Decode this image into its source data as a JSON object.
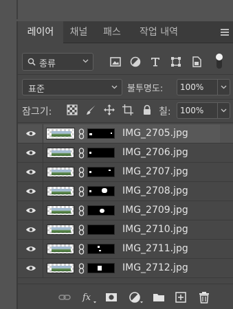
{
  "tabs": [
    {
      "label": "레이어",
      "active": true
    },
    {
      "label": "채널",
      "active": false
    },
    {
      "label": "패스",
      "active": false
    },
    {
      "label": "작업 내역",
      "active": false
    }
  ],
  "filter": {
    "kind_label": "종류",
    "icons": [
      "pixel-layer-filter-icon",
      "adjustment-layer-filter-icon",
      "type-layer-filter-icon",
      "shape-layer-filter-icon",
      "smart-object-filter-icon",
      "filter-toggle-icon"
    ]
  },
  "blend": {
    "mode": "표준",
    "opacity_label": "불투명도:",
    "opacity_value": "100%"
  },
  "lock": {
    "label": "잠그기:",
    "icons": [
      "lock-transparent-pixels-icon",
      "lock-image-pixels-icon",
      "lock-position-icon",
      "lock-artboard-icon",
      "lock-all-icon"
    ],
    "fill_label": "칠:",
    "fill_value": "100%"
  },
  "layers": [
    {
      "name": "IMG_2705.jpg",
      "selected": true,
      "visible": true
    },
    {
      "name": "IMG_2706.jpg",
      "selected": false,
      "visible": true
    },
    {
      "name": "IMG_2707.jpg",
      "selected": false,
      "visible": true
    },
    {
      "name": "IMG_2708.jpg",
      "selected": false,
      "visible": true
    },
    {
      "name": "IMG_2709.jpg",
      "selected": false,
      "visible": true
    },
    {
      "name": "IMG_2710.jpg",
      "selected": false,
      "visible": true
    },
    {
      "name": "IMG_2711.jpg",
      "selected": false,
      "visible": true
    },
    {
      "name": "IMG_2712.jpg",
      "selected": false,
      "visible": true
    }
  ],
  "footer_icons": [
    "link-layers-icon",
    "fx-layer-style-icon",
    "add-mask-icon",
    "adjustment-layer-icon",
    "new-group-folder-icon",
    "new-layer-icon",
    "trash-icon"
  ],
  "colors": {
    "panel_bg": "#474747",
    "selected_row": "#585858",
    "text": "#e4e4e4"
  }
}
